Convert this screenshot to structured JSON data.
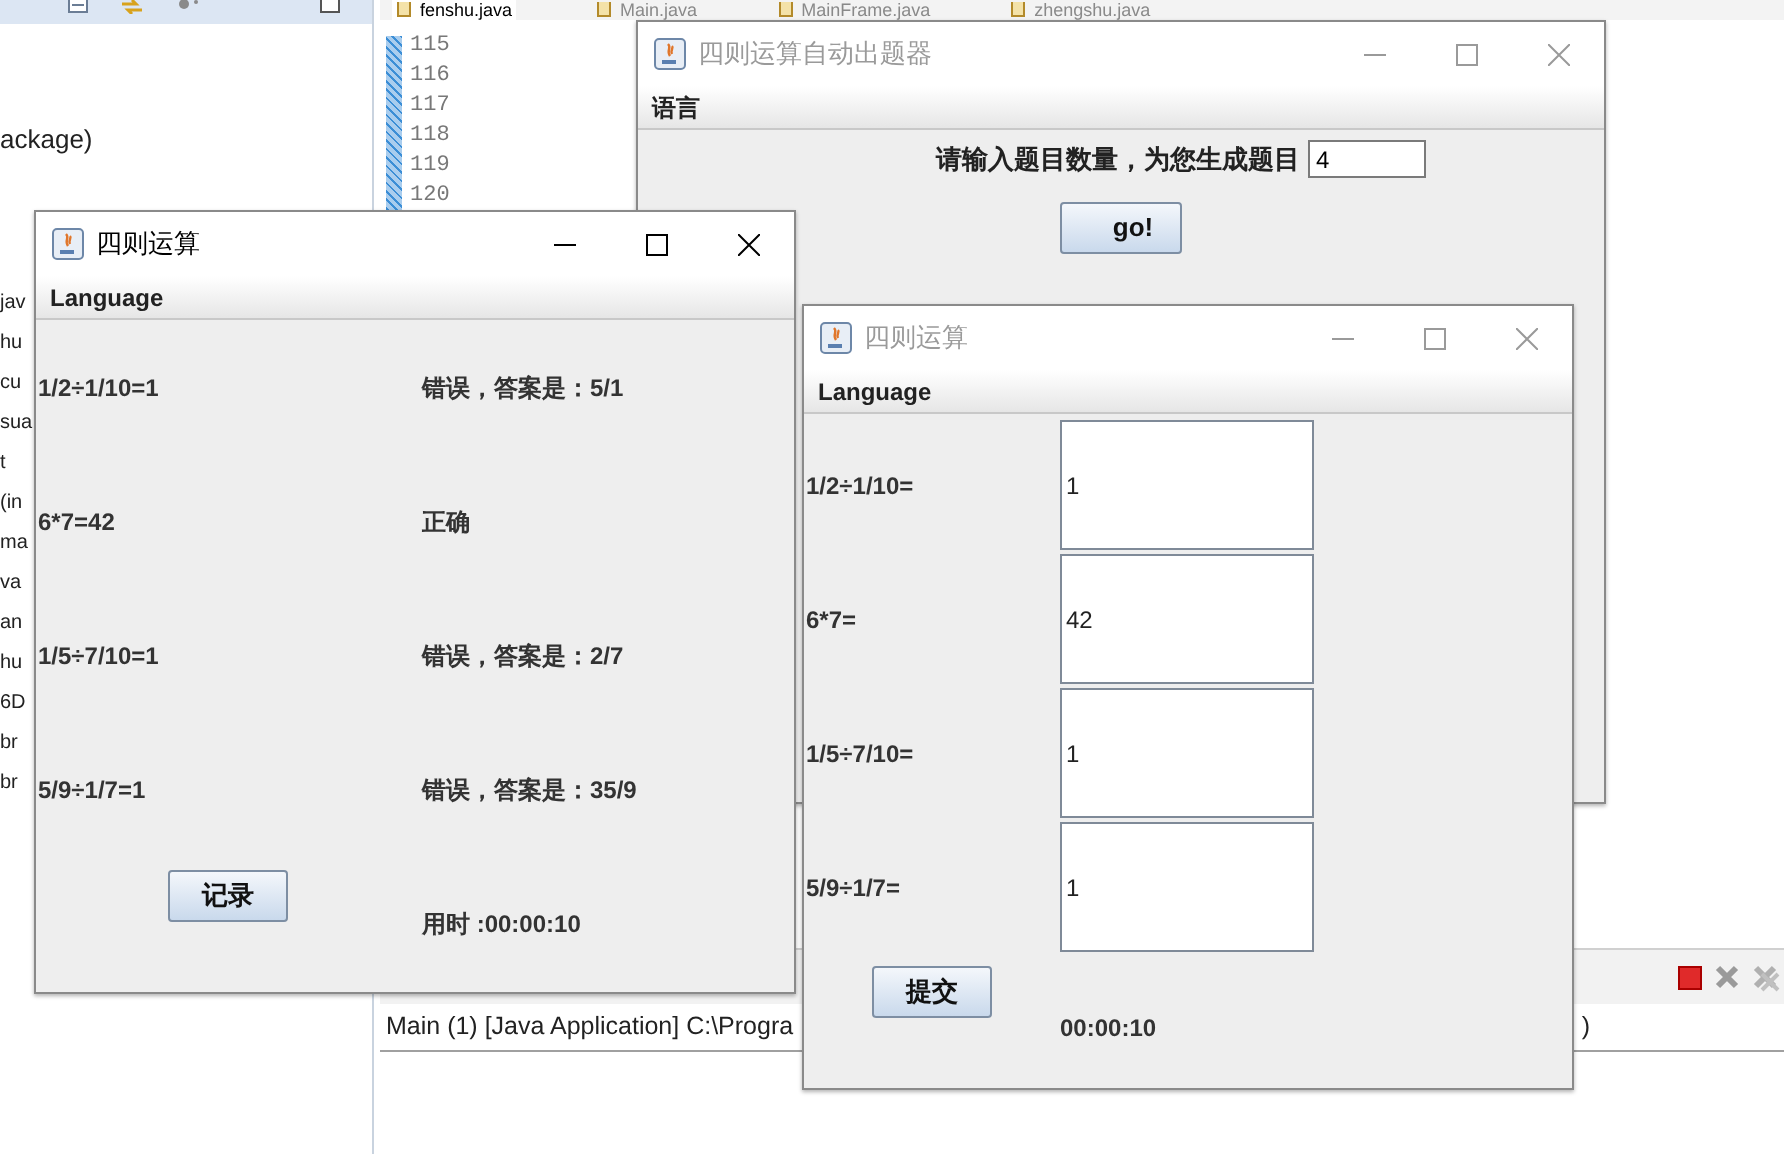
{
  "ide": {
    "explorer_fragment": "ackage)",
    "explorer_rows": [
      "jav",
      "hu",
      "cu",
      "sua",
      "t",
      "(in",
      "ma",
      "va",
      "an",
      "hu",
      "6D",
      "br",
      "br"
    ],
    "editor_tabs": [
      {
        "label": "fenshu.java",
        "selected": true
      },
      {
        "label": "Main.java",
        "selected": false
      },
      {
        "label": "MainFrame.java",
        "selected": false
      },
      {
        "label": "zhengshu.java",
        "selected": false
      }
    ],
    "line_numbers": [
      "115",
      "116",
      "117",
      "118",
      "119",
      "120"
    ],
    "console_line": "Main (1) [Java Application] C:\\Progra",
    "console_tail": ")"
  },
  "windows": [
    {
      "kind": "setup",
      "title": "四则运算自动出题器",
      "active": false,
      "menu": [
        "语言"
      ],
      "prompt": "请输入题目数量，为您生成题目",
      "count_value": "4",
      "button": "go!"
    },
    {
      "kind": "results",
      "title": "四则运算",
      "active": true,
      "menu": [
        "Language"
      ],
      "rows": [
        {
          "expression": "1/2÷1/10=1",
          "verdict": "错误，答案是：5/1"
        },
        {
          "expression": "6*7=42",
          "verdict": "正确"
        },
        {
          "expression": "1/5÷7/10=1",
          "verdict": "错误，答案是：2/7"
        },
        {
          "expression": "5/9÷1/7=1",
          "verdict": "错误，答案是：35/9"
        }
      ],
      "button": "记录",
      "elapsed": "用时 :00:00:10"
    },
    {
      "kind": "quiz",
      "title": "四则运算",
      "active": false,
      "menu": [
        "Language"
      ],
      "rows": [
        {
          "question": "1/2÷1/10=",
          "answer": "1"
        },
        {
          "question": "6*7=",
          "answer": "42"
        },
        {
          "question": "1/5÷7/10=",
          "answer": "1"
        },
        {
          "question": "5/9÷1/7=",
          "answer": "1"
        }
      ],
      "button": "提交",
      "elapsed": "00:00:10"
    }
  ]
}
